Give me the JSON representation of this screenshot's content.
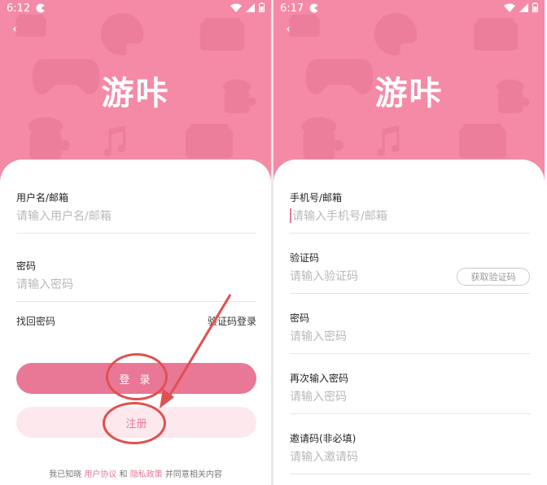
{
  "status_left": {
    "time": "6:12"
  },
  "status_right": {
    "time": "6:17"
  },
  "colors": {
    "brand_pink": "#f48aa6",
    "button_pink": "#e87896",
    "light_pink": "#fde8ee",
    "annotation_red": "#e05050"
  },
  "icons": [
    "back-icon",
    "wifi-icon",
    "signal-icon",
    "battery-icon",
    "gamepad-icon",
    "palette-icon",
    "video-icon",
    "music-icon",
    "coffee-cup-icon"
  ],
  "login": {
    "back": "‹",
    "logo": "游咔",
    "username_label": "用户名/邮箱",
    "username_placeholder": "请输入用户名/邮箱",
    "password_label": "密码",
    "password_placeholder": "请输入密码",
    "forgot_password": "找回密码",
    "code_login": "验证码登录",
    "login_button": "登 录",
    "register_button": "注册",
    "agreement_prefix": "我已知晓",
    "user_agreement": "用户协议",
    "and": "和",
    "privacy_policy": "隐私政策",
    "agreement_suffix": "并同意相关内容"
  },
  "register": {
    "back": "‹",
    "logo": "游咔",
    "phone_label": "手机号/邮箱",
    "phone_placeholder": "请输入手机号/邮箱",
    "code_label": "验证码",
    "code_placeholder": "请输入验证码",
    "get_code_button": "获取验证码",
    "password_label": "密码",
    "password_placeholder": "请输入密码",
    "confirm_label": "再次输入密码",
    "confirm_placeholder": "请输入密码",
    "invite_label": "邀请码(非必填)",
    "invite_placeholder": "请输入邀请码"
  }
}
